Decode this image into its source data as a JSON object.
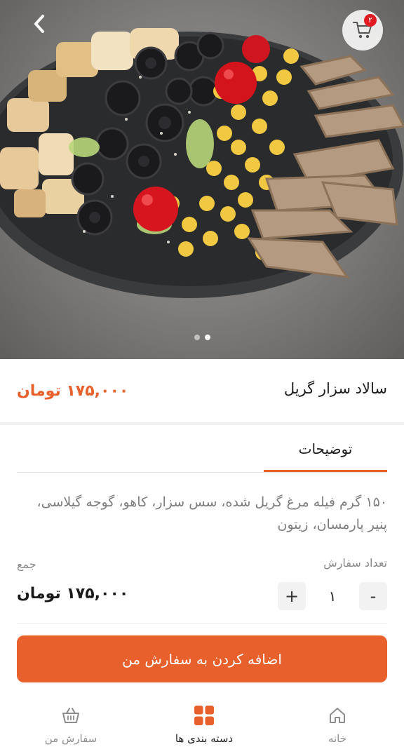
{
  "header": {
    "back_icon": "chevron-left-icon",
    "cart_icon": "shopping-cart-icon",
    "cart_badge": "۲"
  },
  "gallery": {
    "slide_count": 2,
    "active_slide": 2
  },
  "product": {
    "name": "سالاد سزار گریل",
    "price": "۱۷۵,۰۰۰ تومان"
  },
  "tabs": [
    {
      "label": "توضیحات",
      "active": true
    }
  ],
  "description": "۱۵۰ گرم فیله مرغ گریل شده، سس سزار، کاهو، گوجه گیلاسی، پنیر پارمسان، زیتون",
  "order": {
    "quantity_label": "تعداد سفارش",
    "total_label": "جمع",
    "minus": "-",
    "plus": "+",
    "quantity": "۱",
    "total": "۱۷۵,۰۰۰ تومان"
  },
  "add_button": "اضافه کردن به سفارش من",
  "bottom_nav": [
    {
      "label": "خانه",
      "icon": "home-icon",
      "active": false
    },
    {
      "label": "دسته بندی ها",
      "icon": "grid-icon",
      "active": true
    },
    {
      "label": "سفارش من",
      "icon": "basket-icon",
      "active": false
    }
  ],
  "colors": {
    "accent": "#e8602c",
    "badge": "#e21b23"
  }
}
